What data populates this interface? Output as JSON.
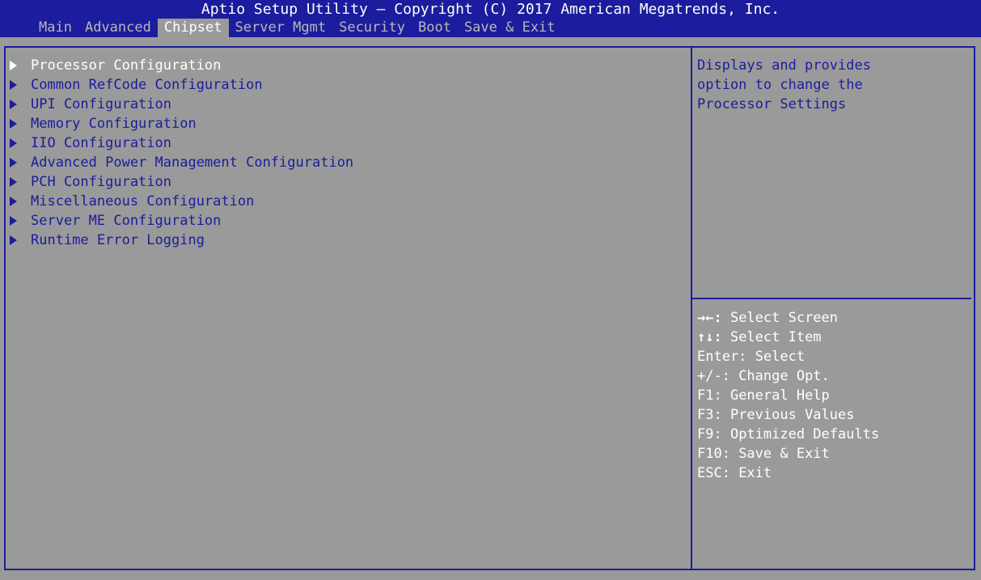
{
  "header": {
    "title": "Aptio Setup Utility – Copyright (C) 2017 American Megatrends, Inc.",
    "tabs": [
      {
        "label": "Main",
        "active": false
      },
      {
        "label": "Advanced",
        "active": false
      },
      {
        "label": "Chipset",
        "active": true
      },
      {
        "label": "Server Mgmt",
        "active": false
      },
      {
        "label": "Security",
        "active": false
      },
      {
        "label": "Boot",
        "active": false
      },
      {
        "label": "Save & Exit",
        "active": false
      }
    ]
  },
  "menu": {
    "items": [
      {
        "label": "Processor Configuration",
        "selected": true
      },
      {
        "label": "Common RefCode Configuration",
        "selected": false
      },
      {
        "label": "UPI Configuration",
        "selected": false
      },
      {
        "label": "Memory Configuration",
        "selected": false
      },
      {
        "label": "IIO Configuration",
        "selected": false
      },
      {
        "label": "Advanced Power Management Configuration",
        "selected": false
      },
      {
        "label": "PCH Configuration",
        "selected": false
      },
      {
        "label": "Miscellaneous Configuration",
        "selected": false
      },
      {
        "label": "Server ME Configuration",
        "selected": false
      },
      {
        "label": "Runtime Error Logging",
        "selected": false
      }
    ]
  },
  "help": {
    "text": "Displays and provides\noption to change the\nProcessor Settings"
  },
  "keys": [
    {
      "key": "→←:",
      "desc": " Select Screen"
    },
    {
      "key": "↑↓:",
      "desc": " Select Item"
    },
    {
      "key": "Enter:",
      "desc": " Select"
    },
    {
      "key": "+/-:",
      "desc": " Change Opt."
    },
    {
      "key": "F1:",
      "desc": " General Help"
    },
    {
      "key": "F3:",
      "desc": " Previous Values"
    },
    {
      "key": "F9:",
      "desc": " Optimized Defaults"
    },
    {
      "key": "F10:",
      "desc": " Save & Exit"
    },
    {
      "key": "ESC:",
      "desc": " Exit"
    }
  ],
  "colors": {
    "background": "#9a9a9a",
    "accent": "#1c1c9e",
    "highlight": "#ffffff"
  }
}
